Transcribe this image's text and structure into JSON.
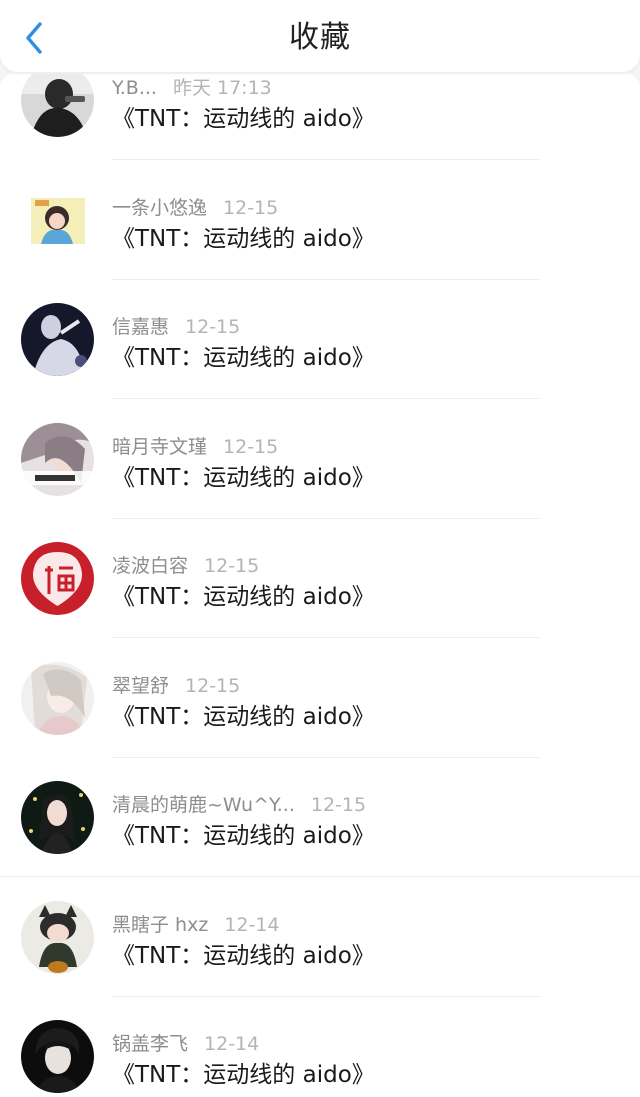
{
  "header": {
    "title": "收藏",
    "back_icon": "chevron-left-icon",
    "accent": "#2b8fe5"
  },
  "items": [
    {
      "username": "Y.B...",
      "time": "昨天 17:13",
      "title": "《TNT：运动线的 aido》"
    },
    {
      "username": "一条小悠逸",
      "time": "12-15",
      "title": "《TNT：运动线的 aido》"
    },
    {
      "username": "信嘉惠",
      "time": "12-15",
      "title": "《TNT：运动线的 aido》"
    },
    {
      "username": "暗月寺文瑾",
      "time": "12-15",
      "title": "《TNT：运动线的 aido》"
    },
    {
      "username": "凌波白容",
      "time": "12-15",
      "title": "《TNT：运动线的 aido》"
    },
    {
      "username": "翠望舒",
      "time": "12-15",
      "title": "《TNT：运动线的 aido》"
    },
    {
      "username": "清晨的萌鹿~Wu^Y...",
      "time": "12-15",
      "title": "《TNT：运动线的 aido》"
    },
    {
      "username": "黑瞎子 hxz",
      "time": "12-14",
      "title": "《TNT：运动线的 aido》"
    },
    {
      "username": "锅盖李飞",
      "time": "12-14",
      "title": "《TNT：运动线的 aido》"
    }
  ]
}
